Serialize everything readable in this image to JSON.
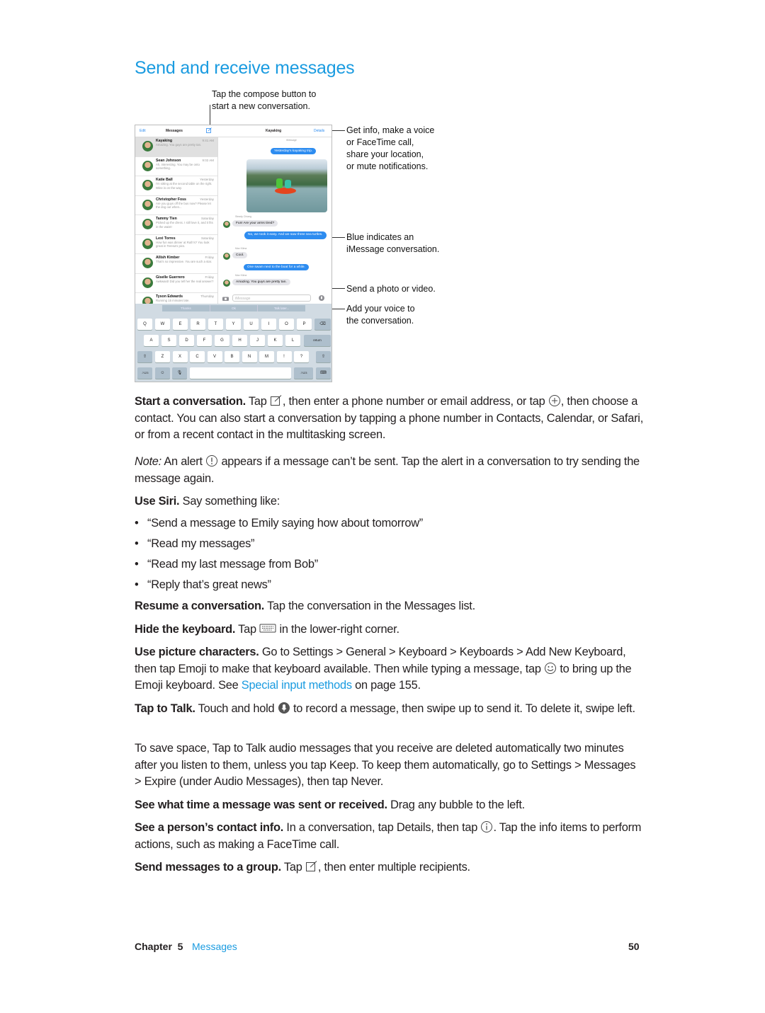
{
  "title": "Send and receive messages",
  "callouts": {
    "compose": [
      "Tap the compose button to",
      "start a new conversation."
    ],
    "details": [
      "Get info, make a voice",
      "or FaceTime call,",
      "share your location,",
      "or mute notifications."
    ],
    "blue": [
      "Blue indicates an",
      "iMessage conversation."
    ],
    "photo": "Send a photo or video.",
    "voice": [
      "Add your voice to",
      "the conversation."
    ]
  },
  "ipad": {
    "edit": "Edit",
    "messages": "Messages",
    "conversation_title": "Kayaking",
    "details": "Details",
    "list": [
      {
        "name": "Kayaking",
        "time": "9:41 AM",
        "preview": "Amazing. You guys are pretty tan."
      },
      {
        "name": "Sean Johnson",
        "time": "9:02 AM",
        "preview": "Ah, interesting. You may be onto something."
      },
      {
        "name": "Katie Ball",
        "time": "Yesterday",
        "preview": "I'm sitting at the second table on the right. Wine is on the way."
      },
      {
        "name": "Christopher Foss",
        "time": "Yesterday",
        "preview": "Are you guys off the bus now? Please let the dog out when..."
      },
      {
        "name": "Tammy Tien",
        "time": "Saturday",
        "preview": "Picked up the dress. I still love it, and it fits in the waist!"
      },
      {
        "name": "Lexi Torres",
        "time": "Saturday",
        "preview": "How fun was dinner at Ruth's? You look great in Teresa's pics."
      },
      {
        "name": "Allish Kimber",
        "time": "Friday",
        "preview": "That's so impressive. You are such a star."
      },
      {
        "name": "Giselle Guerrero",
        "time": "Friday",
        "preview": "Awkward! Did you tell her the real answer?"
      },
      {
        "name": "Tyson Edwards",
        "time": "Thursday",
        "preview": "Running 15 minutes late."
      }
    ],
    "timestamp": "iMessage",
    "bubbles": [
      {
        "text": "Yesterday's kayaking trip.",
        "side": "me"
      },
      {
        "sender": "Steady Chiang",
        "text": "Fun! Are your arms tired?",
        "side": "them"
      },
      {
        "text": "No, we took it easy. And we saw three sea turtles.",
        "side": "me"
      },
      {
        "sender": "Max Kilma",
        "text": "Cool.",
        "side": "them"
      },
      {
        "text": "One swam next to the boat for a while.",
        "side": "me"
      },
      {
        "sender": "Max Kilma",
        "text": "Amazing. You guys are pretty tan.",
        "side": "them"
      }
    ],
    "input_placeholder": "iMessage",
    "suggestions": [
      "Thanks",
      "Ok",
      "Talk later..."
    ],
    "keys_row1": [
      "Q",
      "W",
      "E",
      "R",
      "T",
      "Y",
      "U",
      "I",
      "O",
      "P"
    ],
    "keys_row2": [
      "A",
      "S",
      "D",
      "F",
      "G",
      "H",
      "J",
      "K",
      "L"
    ],
    "return": "return",
    "keys_row3": [
      "Z",
      "X",
      "C",
      "V",
      "B",
      "N",
      "M",
      "!",
      "?"
    ],
    "num_key": ".?123"
  },
  "body": {
    "start": {
      "lead": "Start a conversation.",
      "t1": " Tap ",
      "t2": ", then enter a phone number or email address, or tap ",
      "t3": ", then choose a contact. You can also start a conversation by tapping a phone number in Contacts, Calendar, or Safari, or from a recent contact in the multitasking screen."
    },
    "note": {
      "lead": "Note:",
      "t1": "  An alert ",
      "t2": " appears if a message can’t be sent. Tap the alert in a conversation to try sending the message again."
    },
    "siri": {
      "lead": "Use Siri.",
      "t1": " Say something like:"
    },
    "bullets": [
      "“Send a message to Emily saying how about tomorrow”",
      "“Read my messages”",
      "“Read my last message from Bob”",
      "“Reply that’s great news”"
    ],
    "resume": {
      "lead": "Resume a conversation.",
      "t1": " Tap the conversation in the Messages list."
    },
    "hide": {
      "lead": "Hide the keyboard.",
      "t1": " Tap ",
      "t2": " in the lower-right corner."
    },
    "pictures": {
      "lead": "Use picture characters.",
      "t1": " Go to Settings > General > Keyboard > Keyboards > Add New Keyboard, then tap Emoji to make that keyboard available. Then while typing a message, tap ",
      "t2": " to bring up the Emoji keyboard. See ",
      "link": "Special input methods",
      "t3": " on page 155."
    },
    "talk": {
      "lead": "Tap to Talk.",
      "t1": " Touch and hold ",
      "t2": " to record a message, then swipe up to send it. To delete it, swipe left."
    },
    "save": "To save space, Tap to Talk audio messages that you receive are deleted automatically two minutes after you listen to them, unless you tap Keep. To keep them automatically, go to Settings > Messages > Expire (under Audio Messages), then tap Never.",
    "time": {
      "lead": "See what time a message was sent or received.",
      "t1": " Drag any bubble to the left."
    },
    "contact": {
      "lead": "See a person’s contact info.",
      "t1": " In a conversation, tap Details, then tap ",
      "t2": ". Tap the info items to perform actions, such as making a FaceTime call."
    },
    "group": {
      "lead": "Send messages to a group.",
      "t1": " Tap ",
      "t2": ", then enter multiple recipients."
    }
  },
  "footer": {
    "chapter": "Chapter  5",
    "section": "Messages",
    "page": "50"
  },
  "colors": {
    "accent": "#1a9be0",
    "bubble_blue": "#2d8cf0"
  }
}
